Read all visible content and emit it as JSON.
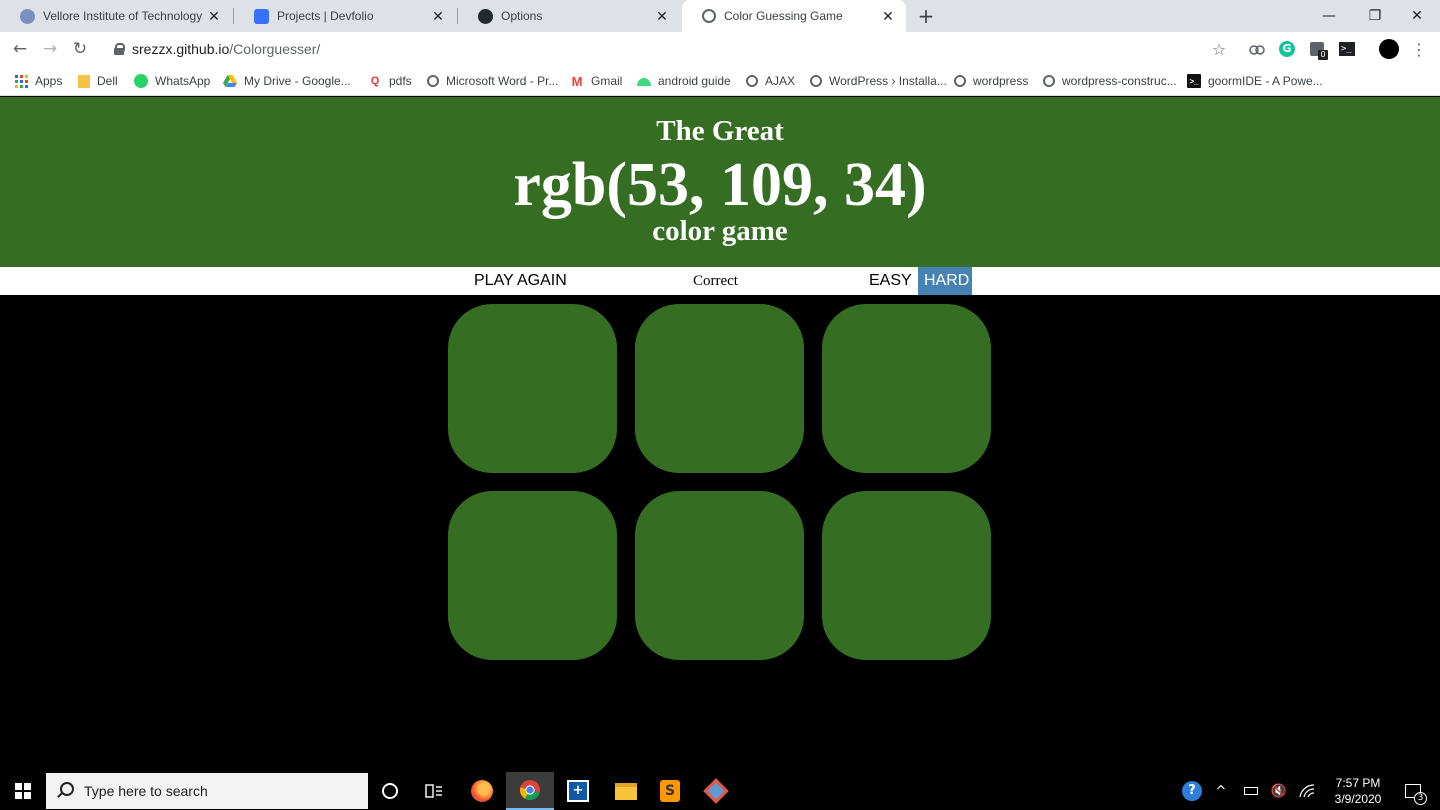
{
  "browser": {
    "tabs": [
      {
        "title": "Vellore Institute of Technology (V",
        "close": "✕"
      },
      {
        "title": "Projects | Devfolio",
        "close": "✕"
      },
      {
        "title": "Options",
        "close": "✕"
      },
      {
        "title": "Color Guessing Game",
        "close": "✕"
      }
    ],
    "new_tab": "+",
    "window_controls": {
      "minimize": "—",
      "maximize": "❐",
      "close": "✕"
    },
    "url_host": "srezzx.github.io",
    "url_path": "/Colorguesser/",
    "bookmarks": [
      {
        "label": "Apps"
      },
      {
        "label": "Dell"
      },
      {
        "label": "WhatsApp"
      },
      {
        "label": "My Drive - Google..."
      },
      {
        "label": "pdfs"
      },
      {
        "label": "Microsoft Word - Pr..."
      },
      {
        "label": "Gmail"
      },
      {
        "label": "android guide"
      },
      {
        "label": "AJAX"
      },
      {
        "label": "WordPress › Installa..."
      },
      {
        "label": "wordpress"
      },
      {
        "label": "wordpress-construc..."
      },
      {
        "label": "goormIDE - A Powe..."
      }
    ],
    "extension_badge": "0"
  },
  "game": {
    "title_top": "The Great",
    "rgb_display": "rgb(53, 109, 34)",
    "title_bottom": "color game",
    "play_again_label": "PLAY AGAIN",
    "message": "Correct",
    "easy_label": "EASY",
    "hard_label": "HARD",
    "selected_mode": "HARD",
    "header_color": "#356d22",
    "square_colors": [
      "#356d22",
      "#356d22",
      "#356d22",
      "#356d22",
      "#356d22",
      "#356d22"
    ],
    "selected_button_color": "#4682b4"
  },
  "taskbar": {
    "search_placeholder": "Type here to search",
    "time": "7:57 PM",
    "date": "3/9/2020",
    "notification_count": "3"
  }
}
